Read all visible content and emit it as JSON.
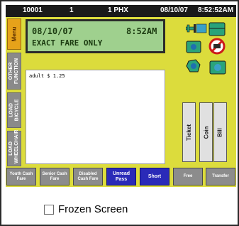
{
  "status_bar": {
    "route": "10001",
    "direction": "1",
    "operator": "1 PHX",
    "date": "08/10/07",
    "time": "8:52:52AM"
  },
  "sidebar": [
    {
      "label": "Menu"
    },
    {
      "label": "OTHER FUNCTION"
    },
    {
      "label": "LOAD BICYCLE"
    },
    {
      "label": "LOAD WHEELCHAIR"
    }
  ],
  "display": {
    "date": "08/10/07",
    "time": "8:52AM",
    "message": "EXACT FARE ONLY"
  },
  "ticket_area": {
    "line": "adult $ 1.25"
  },
  "status_icons": [
    "card-reader-icon",
    "farebox-icon",
    "no-entry-icon",
    "coin-icon",
    "bill-validator-icon"
  ],
  "payment_buttons": {
    "ticket": "Ticket",
    "coin": "Coin",
    "bill": "Bill"
  },
  "fare_buttons": [
    {
      "label": "Youth Cash Fare",
      "style": "grey"
    },
    {
      "label": "Senior Cash Fare",
      "style": "grey"
    },
    {
      "label": "Disabled Cash Fare",
      "style": "grey"
    },
    {
      "label": "Unread Pass",
      "style": "blue"
    },
    {
      "label": "Short",
      "style": "blue"
    },
    {
      "label": "Free",
      "style": "grey"
    },
    {
      "label": "Transfer",
      "style": "grey"
    }
  ],
  "frozen_screen": {
    "label": "Frozen Screen",
    "checked": false
  },
  "colors": {
    "screen_bg": "#dcdc3c",
    "lcd_bg": "#9fd08e",
    "menu_orange": "#e6a21a",
    "accent_blue": "#2a2ab8",
    "stop_red": "#cc1a1a",
    "icon_teal": "#2aa37a"
  }
}
